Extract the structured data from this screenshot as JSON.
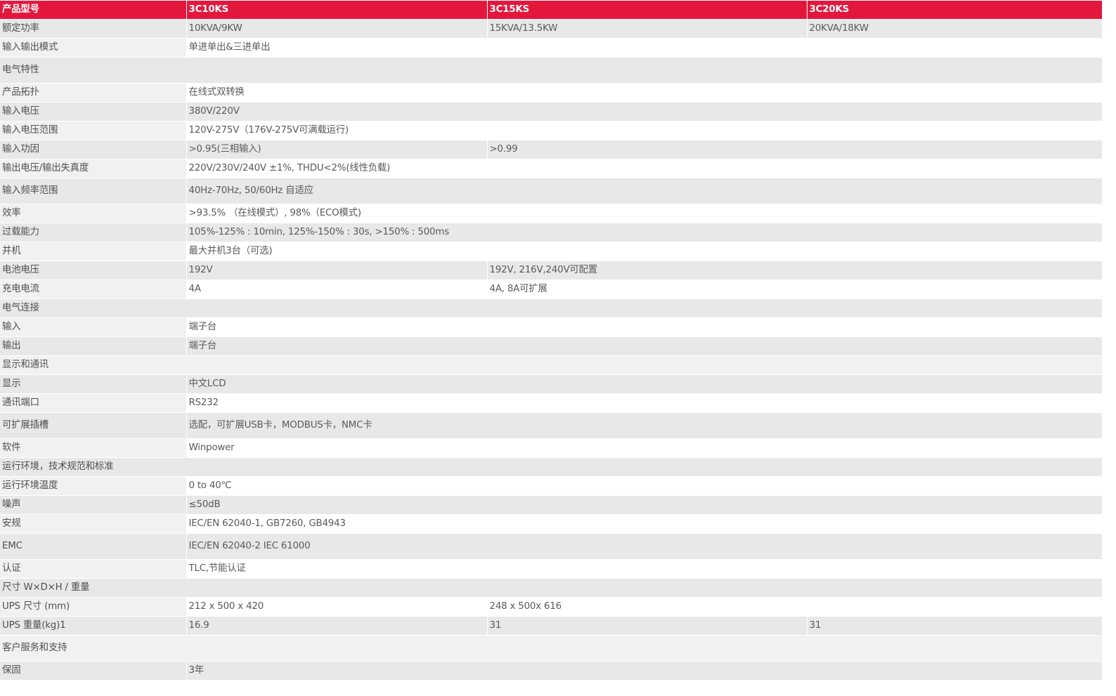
{
  "table": {
    "header": [
      "产品型号",
      "3C10KS",
      "3C15KS",
      "3C20KS"
    ],
    "rows": [
      {
        "cells": [
          "额定功率",
          "10KVA/9KW",
          "15KVA/13.5KW",
          "20KVA/18KW"
        ]
      },
      {
        "cells": [
          "输入输出模式",
          "单进单出&三进单出"
        ]
      },
      {
        "cells": [
          "电气特性"
        ]
      },
      {
        "cells": [
          "产品拓扑",
          "在线式双转换"
        ]
      },
      {
        "cells": [
          "输入电压",
          "380V/220V"
        ]
      },
      {
        "cells": [
          "输入电压范围",
          "120V-275V（176V-275V可满载运行)"
        ]
      },
      {
        "cells": [
          "输入功因",
          ">0.95(三相输入)",
          ">0.99"
        ]
      },
      {
        "cells": [
          "输出电压/输出失真度",
          "220V/230V/240V ±1%, THDU<2%(线性负载)"
        ]
      },
      {
        "cells": [
          "输入频率范围",
          "40Hz-70Hz, 50/60Hz 自适应"
        ]
      },
      {
        "cells": [
          "效率",
          ">93.5% （在线模式）, 98%（ECO模式)"
        ]
      },
      {
        "cells": [
          "过载能力",
          "105%-125% : 10min, 125%-150% : 30s, >150% : 500ms"
        ]
      },
      {
        "cells": [
          "并机",
          "最大并机3台（可选)"
        ]
      },
      {
        "cells": [
          "电池电压",
          "192V",
          "192V, 216V,240V可配置"
        ]
      },
      {
        "cells": [
          "充电电流",
          "4A",
          "4A, 8A可扩展"
        ]
      },
      {
        "cells": [
          "电气连接"
        ]
      },
      {
        "cells": [
          "输入",
          "端子台"
        ]
      },
      {
        "cells": [
          "输出",
          "端子台"
        ]
      },
      {
        "cells": [
          "显示和通讯"
        ]
      },
      {
        "cells": [
          "显示",
          "中文LCD"
        ]
      },
      {
        "cells": [
          "通讯端口",
          "RS232"
        ]
      },
      {
        "cells": [
          "可扩展插槽",
          "选配，可扩展USB卡，MODBUS卡，NMC卡"
        ]
      },
      {
        "cells": [
          "软件",
          "Winpower"
        ]
      },
      {
        "cells": [
          "运行环境，技术规范和标准"
        ]
      },
      {
        "cells": [
          "运行环境温度",
          "0 to 40℃"
        ]
      },
      {
        "cells": [
          "噪声",
          "≤50dB"
        ]
      },
      {
        "cells": [
          "安规",
          "IEC/EN 62040-1, GB7260, GB4943"
        ]
      },
      {
        "cells": [
          "EMC",
          "IEC/EN 62040-2 IEC 61000"
        ]
      },
      {
        "cells": [
          "认证",
          "TLC,节能认证"
        ]
      },
      {
        "cells": [
          "尺寸 W×D×H / 重量"
        ]
      },
      {
        "cells": [
          "UPS 尺寸 (mm)",
          "212 x 500 x 420",
          "248 x 500x 616"
        ]
      },
      {
        "cells": [
          "UPS 重量(kg)1",
          "16.9",
          "31",
          "31"
        ]
      },
      {
        "cells": [
          "客户服务和支持"
        ]
      },
      {
        "cells": [
          "保固",
          "3年"
        ]
      }
    ]
  },
  "colors": {
    "header_bg": "#e3173c",
    "header_text": "#ffffff",
    "row_alt_bg": "#e8e8e8",
    "row_bg": "#ffffff",
    "text": "#5a5a5a"
  }
}
